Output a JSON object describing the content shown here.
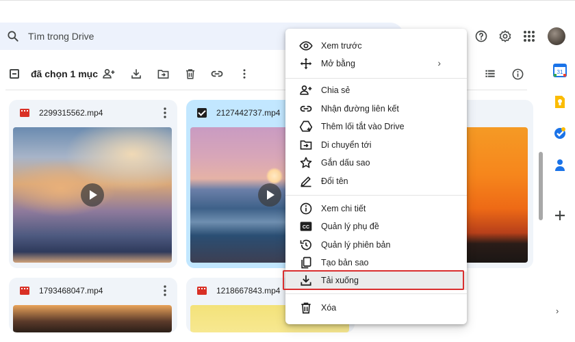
{
  "search": {
    "placeholder": "Tìm trong Drive"
  },
  "header": {
    "icons": [
      "help-icon",
      "settings-icon",
      "apps-grid-icon",
      "avatar"
    ]
  },
  "selection_toolbar": {
    "count_label": "đã chọn 1 mục",
    "actions": [
      "share-icon",
      "download-icon",
      "move-icon",
      "trash-icon",
      "link-icon",
      "more-icon"
    ],
    "right_actions": [
      "list-view-icon",
      "info-icon"
    ]
  },
  "files": [
    {
      "name": "2299315562.mp4",
      "selected": false,
      "type": "video"
    },
    {
      "name": "2127442737.mp4",
      "selected": true,
      "type": "video"
    },
    {
      "name": "1793468047.mp4",
      "selected": false,
      "type": "video"
    },
    {
      "name": "1218667843.mp4",
      "selected": false,
      "type": "video"
    }
  ],
  "context_menu": {
    "items": [
      {
        "label": "Xem trước",
        "icon": "eye-icon"
      },
      {
        "label": "Mở bằng",
        "icon": "open-with-icon",
        "submenu": true
      },
      {
        "label": "Chia sẻ",
        "icon": "person-add-icon"
      },
      {
        "label": "Nhận đường liên kết",
        "icon": "link-icon"
      },
      {
        "label": "Thêm lối tắt vào Drive",
        "icon": "add-shortcut-icon"
      },
      {
        "label": "Di chuyển tới",
        "icon": "move-folder-icon"
      },
      {
        "label": "Gắn dấu sao",
        "icon": "star-icon"
      },
      {
        "label": "Đổi tên",
        "icon": "pencil-icon"
      },
      {
        "label": "Xem chi tiết",
        "icon": "info-icon"
      },
      {
        "label": "Quản lý phụ đề",
        "icon": "cc-icon"
      },
      {
        "label": "Quản lý phiên bản",
        "icon": "history-icon"
      },
      {
        "label": "Tạo bản sao",
        "icon": "copy-icon"
      },
      {
        "label": "Tải xuống",
        "icon": "download-icon",
        "highlighted": true
      },
      {
        "label": "Xóa",
        "icon": "trash-icon"
      }
    ]
  },
  "side_panel": {
    "apps": [
      "calendar-icon",
      "keep-icon",
      "tasks-icon",
      "contacts-icon",
      "add-icon"
    ],
    "calendar_day": "31"
  },
  "colors": {
    "search_bg": "#edf2fc",
    "card_bg": "#f0f4f9",
    "selected_card_bg": "#c2e7ff",
    "highlight_border": "#d92d2d",
    "video_icon": "#d93025"
  }
}
